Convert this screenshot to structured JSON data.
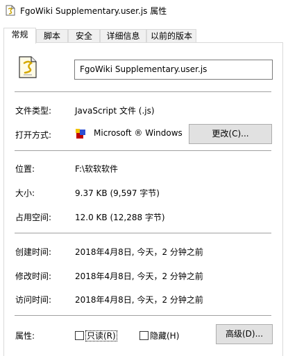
{
  "window": {
    "title": "FgoWiki Supplementary.user.js 属性",
    "title_icon": "script-file-icon"
  },
  "tabs": [
    {
      "label": "常规",
      "active": true
    },
    {
      "label": "脚本",
      "active": false
    },
    {
      "label": "安全",
      "active": false
    },
    {
      "label": "详细信息",
      "active": false
    },
    {
      "label": "以前的版本",
      "active": false
    }
  ],
  "general": {
    "file_icon": "script-file-icon",
    "filename": "FgoWiki Supplementary.user.js",
    "type_label": "文件类型:",
    "type_value": "JavaScript 文件 (.js)",
    "opens_with_label": "打开方式:",
    "opens_with_icon": "windows-script-host-icon",
    "opens_with_value": "Microsoft ® Windows",
    "change_button": "更改(C)...",
    "location_label": "位置:",
    "location_value": "F:\\软软软件",
    "size_label": "大小:",
    "size_value": "9.37 KB (9,597 字节)",
    "size_on_disk_label": "占用空间:",
    "size_on_disk_value": "12.0 KB (12,288 字节)",
    "created_label": "创建时间:",
    "created_value": "2018年4月8日, 今天，2 分钟之前",
    "modified_label": "修改时间:",
    "modified_value": "2018年4月8日, 今天，2 分钟之前",
    "accessed_label": "访问时间:",
    "accessed_value": "2018年4月8日, 今天，2 分钟之前",
    "attributes_label": "属性:",
    "readonly_label": "只读(R)",
    "readonly_checked": false,
    "hidden_label": "隐藏(H)",
    "hidden_checked": false,
    "advanced_button": "高级(D)..."
  }
}
